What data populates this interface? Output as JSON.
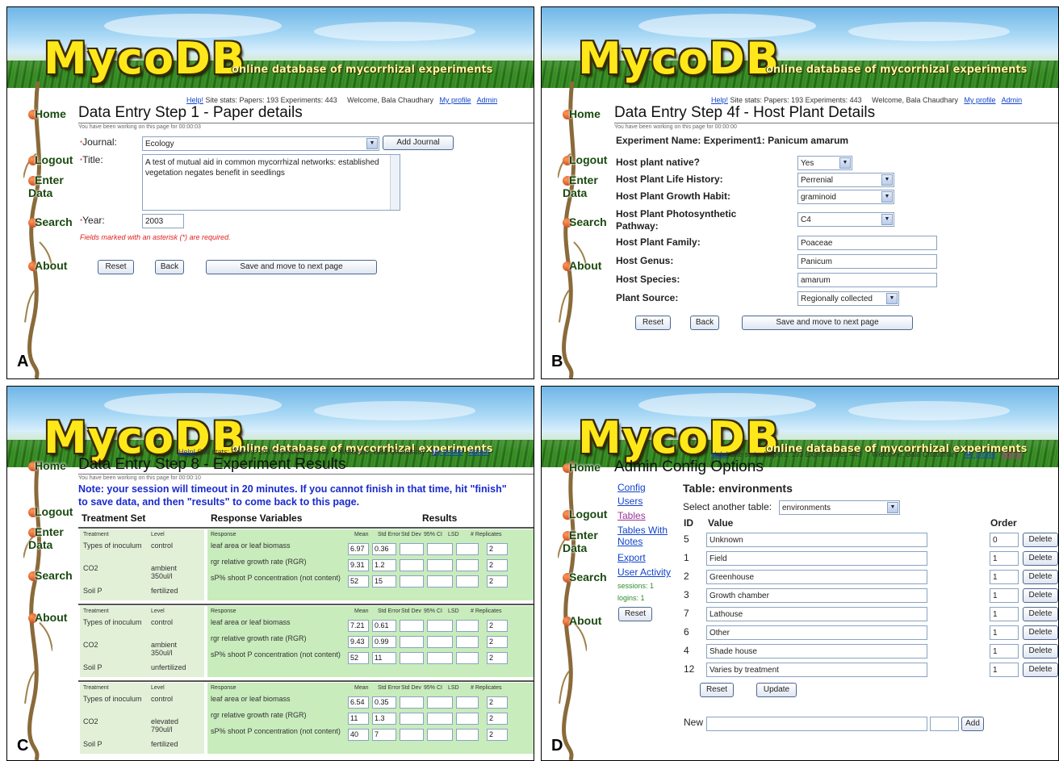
{
  "common": {
    "logo": "MycoDB",
    "tagline": "online database of mycorrhizal experiments",
    "help": "Help!",
    "stats": "Site stats: Papers: 193 Experiments: 443",
    "welcome": "Welcome, Bala Chaudhary",
    "my_profile": "My profile",
    "admin": "Admin",
    "nav": [
      "Home",
      "Logout",
      "Enter Data",
      "Search",
      "About"
    ],
    "reset": "Reset",
    "back": "Back",
    "save_next": "Save and move to next page"
  },
  "panelA": {
    "corner": "A",
    "title": "Data Entry Step 1 - Paper details",
    "working": "You have been working on this page for 00:00:03",
    "journal_label": "Journal:",
    "journal_value": "Ecology",
    "add_journal": "Add Journal",
    "title_label": "Title:",
    "title_value": "A test of mutual aid in common mycorrhizal networks: established vegetation negates benefit in seedlings",
    "year_label": "Year:",
    "year_value": "2003",
    "required_note": "Fields marked with an asterisk (*) are required."
  },
  "panelB": {
    "corner": "B",
    "title": "Data Entry Step 4f - Host Plant Details",
    "working": "You have been working on this page for 00:00:00",
    "experiment": "Experiment Name: Experiment1: Panicum amarum",
    "fields": [
      {
        "label": "Host plant native?",
        "value": "Yes",
        "kind": "select"
      },
      {
        "label": "Host Plant Life History:",
        "value": "Perrenial",
        "kind": "select"
      },
      {
        "label": "Host Plant Growth Habit:",
        "value": "graminoid",
        "kind": "select"
      },
      {
        "label": "Host Plant Photosynthetic Pathway:",
        "value": "C4",
        "kind": "select"
      },
      {
        "label": "Host Plant Family:",
        "value": "Poaceae",
        "kind": "input"
      },
      {
        "label": "Host Genus:",
        "value": "Panicum",
        "kind": "input"
      },
      {
        "label": "Host Species:",
        "value": "amarum",
        "kind": "input"
      },
      {
        "label": "Plant Source:",
        "value": "Regionally collected",
        "kind": "select"
      }
    ]
  },
  "panelC": {
    "corner": "C",
    "title": "Data Entry Step 8 - Experiment Results",
    "working": "You have been working on this page for 00:00:10",
    "note_line1": "Note: your session will timeout in 20 minutes. If you cannot finish in that time, hit \"finish\"",
    "note_line2": "to save data, and then \"results\" to come back to this page.",
    "col_treatment_set": "Treatment Set",
    "col_response_variables": "Response Variables",
    "col_results": "Results",
    "hdr_treatment": "Treatment",
    "hdr_level": "Level",
    "hdr_response": "Response",
    "hdr_stats": [
      "Mean",
      "Std Error",
      "Std Dev",
      "95% CI",
      "LSD",
      "# Replicates"
    ],
    "responses": [
      "leaf area or leaf biomass",
      "rgr relative growth rate (RGR)",
      "sP% shoot P concentration (not content)"
    ],
    "blocks": [
      {
        "treatments": [
          [
            "Types of inoculum",
            "control"
          ],
          [
            "CO2",
            "ambient 350ul/l"
          ],
          [
            "Soil P",
            "fertilized"
          ]
        ],
        "results": [
          [
            "6.97",
            "0.36",
            "2"
          ],
          [
            "9.31",
            "1.2",
            "2"
          ],
          [
            "52",
            "15",
            "2"
          ]
        ]
      },
      {
        "treatments": [
          [
            "Types of inoculum",
            "control"
          ],
          [
            "CO2",
            "ambient 350ul/l"
          ],
          [
            "Soil P",
            "unfertilized"
          ]
        ],
        "results": [
          [
            "7.21",
            "0.61",
            "2"
          ],
          [
            "9.43",
            "0.99",
            "2"
          ],
          [
            "52",
            "11",
            "2"
          ]
        ]
      },
      {
        "treatments": [
          [
            "Types of inoculum",
            "control"
          ],
          [
            "CO2",
            "elevated 790ul/l"
          ],
          [
            "Soil P",
            "fertilized"
          ]
        ],
        "results": [
          [
            "6.54",
            "0.35",
            "2"
          ],
          [
            "11",
            "1.3",
            "2"
          ],
          [
            "40",
            "7",
            "2"
          ]
        ]
      }
    ]
  },
  "panelD": {
    "corner": "D",
    "title": "Admin Config Options",
    "side_links": [
      "Config",
      "Users",
      "Tables",
      "Tables With Notes",
      "Export",
      "User Activity"
    ],
    "sessions": "sessions: 1",
    "logins": "logins: 1",
    "table_title": "Table: environments",
    "select_label": "Select another table:",
    "select_value": "environments",
    "col_id": "ID",
    "col_value": "Value",
    "col_order": "Order",
    "rows": [
      {
        "id": "5",
        "value": "Unknown",
        "order": "0"
      },
      {
        "id": "1",
        "value": "Field",
        "order": "1"
      },
      {
        "id": "2",
        "value": "Greenhouse",
        "order": "1"
      },
      {
        "id": "3",
        "value": "Growth chamber",
        "order": "1"
      },
      {
        "id": "7",
        "value": "Lathouse",
        "order": "1"
      },
      {
        "id": "6",
        "value": "Other",
        "order": "1"
      },
      {
        "id": "4",
        "value": "Shade house",
        "order": "1"
      },
      {
        "id": "12",
        "value": "Varies by treatment",
        "order": "1"
      }
    ],
    "delete": "Delete",
    "update": "Update",
    "new_label": "New",
    "add": "Add"
  }
}
